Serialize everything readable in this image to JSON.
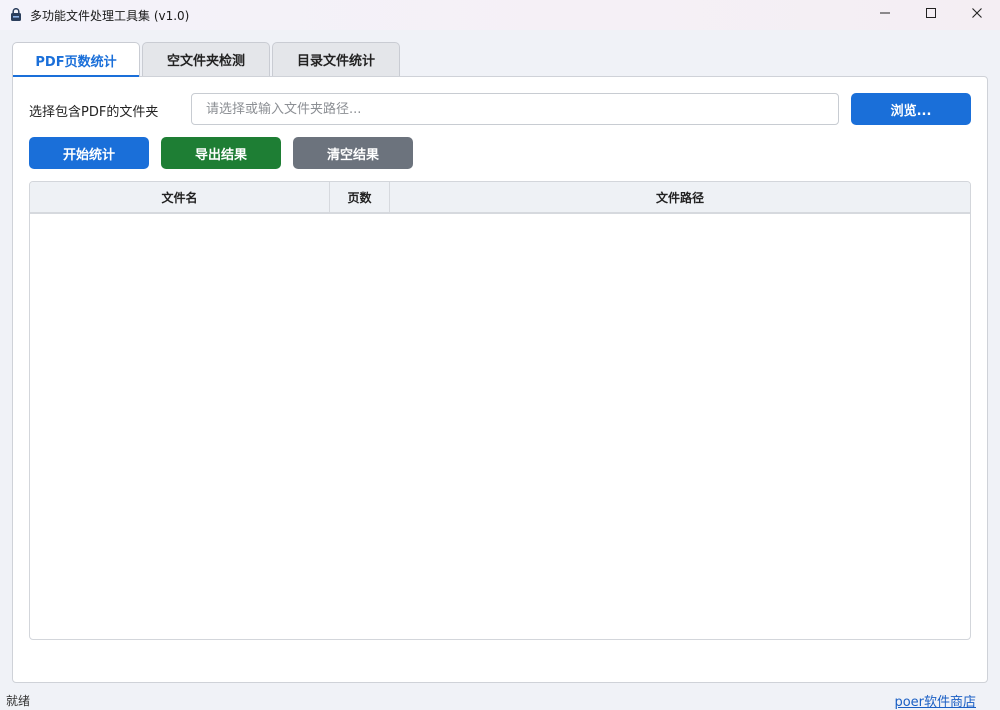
{
  "window": {
    "title": "多功能文件处理工具集 (v1.0)",
    "icons": {
      "app": "lock-icon",
      "minimize": "minimize-icon",
      "maximize": "maximize-icon",
      "close": "close-icon"
    }
  },
  "tabs": [
    {
      "label": "PDF页数统计",
      "active": true
    },
    {
      "label": "空文件夹检测",
      "active": false
    },
    {
      "label": "目录文件统计",
      "active": false
    }
  ],
  "folder": {
    "label": "选择包含PDF的文件夹",
    "placeholder": "请选择或输入文件夹路径...",
    "value": "",
    "browse_label": "浏览..."
  },
  "actions": {
    "start_label": "开始统计",
    "export_label": "导出结果",
    "clear_label": "清空结果"
  },
  "table": {
    "columns": [
      "文件名",
      "页数",
      "文件路径"
    ],
    "rows": []
  },
  "status": {
    "text": "就绪",
    "link": "poer软件商店"
  },
  "colors": {
    "accent": "#1a6fd9",
    "export": "#1e7e34",
    "clear": "#6c737d",
    "link": "#1a5fc4"
  }
}
